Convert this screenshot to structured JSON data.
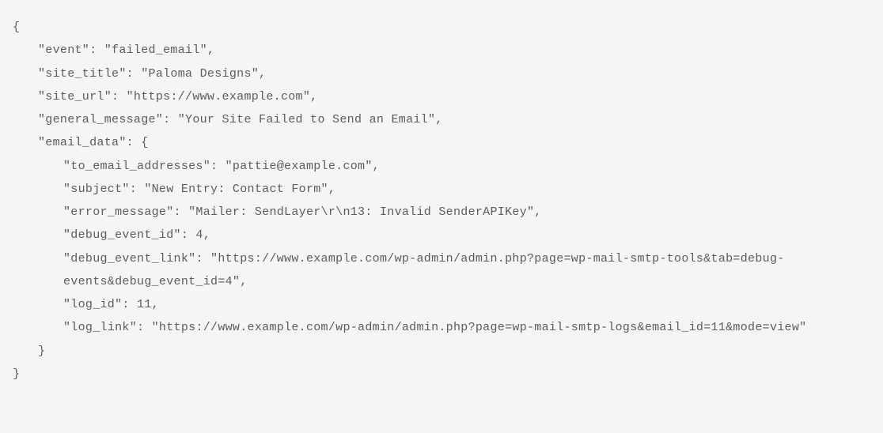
{
  "code": {
    "open_brace": "{",
    "close_brace": "}",
    "open_brace2": "{",
    "close_brace2": "}",
    "event_line": "\"event\": \"failed_email\",",
    "site_title_line": "\"site_title\": \"Paloma Designs\",",
    "site_url_line": "\"site_url\": \"https://www.example.com\",",
    "general_message_line": "\"general_message\": \"Your Site Failed to Send an Email\",",
    "email_data_open": "\"email_data\": {",
    "to_email_line": "\"to_email_addresses\": \"pattie@example.com\",",
    "subject_line": "\"subject\": \"New Entry: Contact Form\",",
    "error_message_line": "\"error_message\": \"Mailer: SendLayer\\r\\n13: Invalid SenderAPIKey\",",
    "debug_event_id_line": "\"debug_event_id\": 4,",
    "debug_event_link_line": "\"debug_event_link\": \"https://www.example.com/wp-admin/admin.php?page=wp-mail-smtp-tools&tab=debug-events&debug_event_id=4\",",
    "log_id_line": "\"log_id\": 11,",
    "log_link_line": "\"log_link\": \"https://www.example.com/wp-admin/admin.php?page=wp-mail-smtp-logs&email_id=11&mode=view\""
  }
}
